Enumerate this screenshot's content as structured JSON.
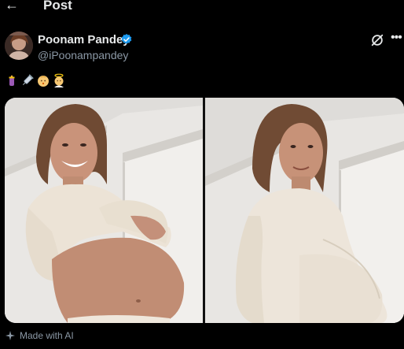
{
  "header": {
    "back_icon": "arrow-left-icon",
    "title": "Post"
  },
  "author": {
    "name": "Poonam Pandey",
    "handle": "@iPoonampandey",
    "verified": true,
    "verified_color": "#1d9bf0"
  },
  "actions": {
    "grok_icon": "grok-icon",
    "more_icon": "more-horizontal-icon"
  },
  "post": {
    "emojis": [
      "baby-bottle-emoji",
      "syringe-emoji",
      "baby-face-emoji",
      "angel-baby-emoji"
    ],
    "images": [
      "photo-pregnant-woman-holding-shirt",
      "photo-pregnant-woman-side-profile"
    ]
  },
  "footer": {
    "made_with_ai": "Made with AI",
    "icon": "sparkle-icon"
  },
  "colors": {
    "background": "#000000",
    "text": "#e7e9ea",
    "muted": "#8b98a5"
  }
}
